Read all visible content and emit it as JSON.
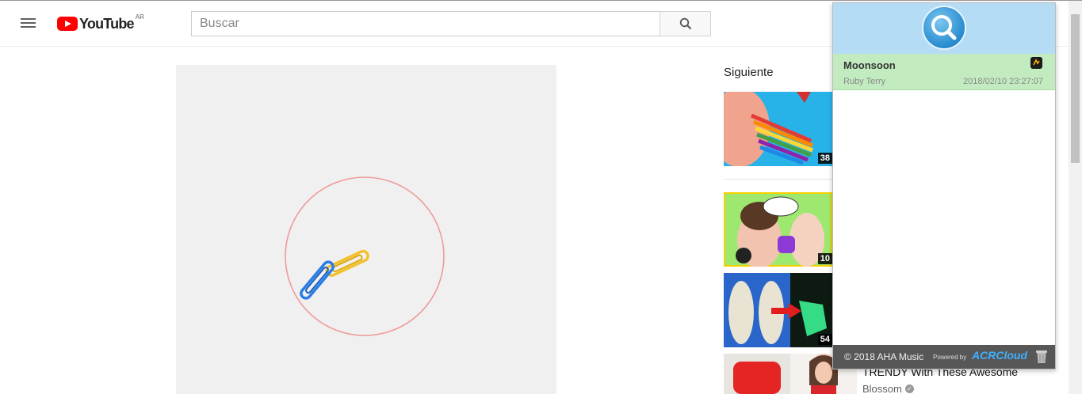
{
  "youtube": {
    "logo_text": "YouTube",
    "country_code": "AR",
    "search_placeholder": "Buscar"
  },
  "up_next": {
    "title": "Siguiente",
    "items": [
      {
        "duration": "38"
      },
      {
        "duration": "10"
      },
      {
        "duration": "54"
      },
      {
        "title": "TRENDY With These Awesome",
        "channel": "Blossom"
      }
    ]
  },
  "extension": {
    "result": {
      "song": "Moonsoon",
      "artist": "Ruby Terry",
      "timestamp": "2018/02/10 23:27:07"
    },
    "footer": {
      "copyright": "© 2018 AHA Music",
      "powered_by": "Powered by",
      "brand": "ACRCloud"
    }
  },
  "colors": {
    "youtube_red": "#ff0000",
    "popup_header": "#b5dcf5",
    "result_bg": "#c2ecc0",
    "footer_bg": "#575757",
    "acr_blue": "#3fb0ff"
  }
}
